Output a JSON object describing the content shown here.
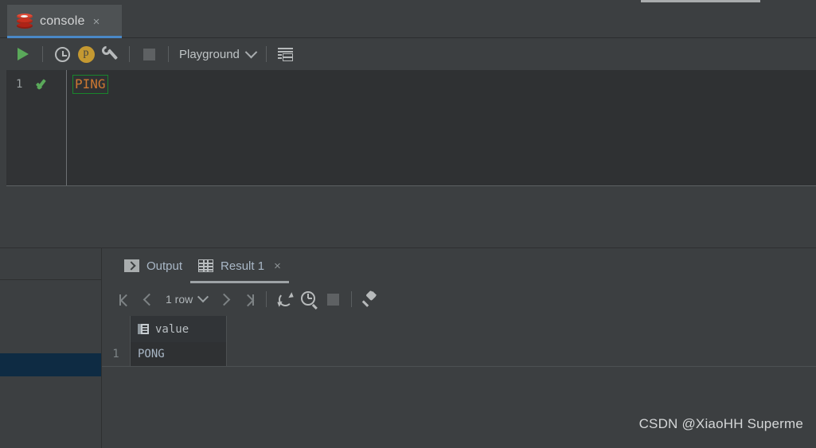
{
  "window": {
    "tab": {
      "title": "console",
      "icon": "redis-logo-icon",
      "close": "×"
    }
  },
  "editor_toolbar": {
    "run_icon": "play-icon",
    "history_icon": "clock-icon",
    "profile_icon": "p-badge-icon",
    "settings_icon": "wrench-icon",
    "stop_icon": "stop-square-icon",
    "schema_selector": "Playground",
    "schema_chevron": "chevron-down-icon",
    "table_view_icon": "table-grid-icon"
  },
  "editor": {
    "line_number": "1",
    "status_icon": "green-check-icon",
    "code": "PING",
    "code_color": "#cc7832",
    "token_outline_color": "#18852c"
  },
  "result_panel": {
    "tabs": [
      {
        "label": "Output",
        "icon": "output-console-icon",
        "active": false,
        "closable": false
      },
      {
        "label": "Result 1",
        "icon": "result-table-icon",
        "active": true,
        "closable": true,
        "close": "×"
      }
    ],
    "toolbar": {
      "first_page_icon": "go-to-first-icon",
      "prev_page_icon": "go-to-previous-icon",
      "row_count": "1 row",
      "row_count_chevron": "chevron-down-icon",
      "next_page_icon": "go-to-next-icon",
      "last_page_icon": "go-to-last-icon",
      "refresh_icon": "refresh-icon",
      "query_history_icon": "clock-search-icon",
      "stop_icon": "stop-square-icon",
      "pin_icon": "pin-icon"
    },
    "grid": {
      "columns": [
        {
          "name": "value",
          "icon": "column-icon"
        }
      ],
      "rows": [
        {
          "number": "1",
          "cells": [
            "PONG"
          ]
        }
      ]
    }
  },
  "watermark": "CSDN @XiaoHH Superme",
  "colors": {
    "accent_blue": "#4a88c7",
    "selection_blue": "#0e2b43",
    "panel_bg": "#3c3f41",
    "editor_bg": "#2f3133",
    "text": "#a9b7c6"
  }
}
